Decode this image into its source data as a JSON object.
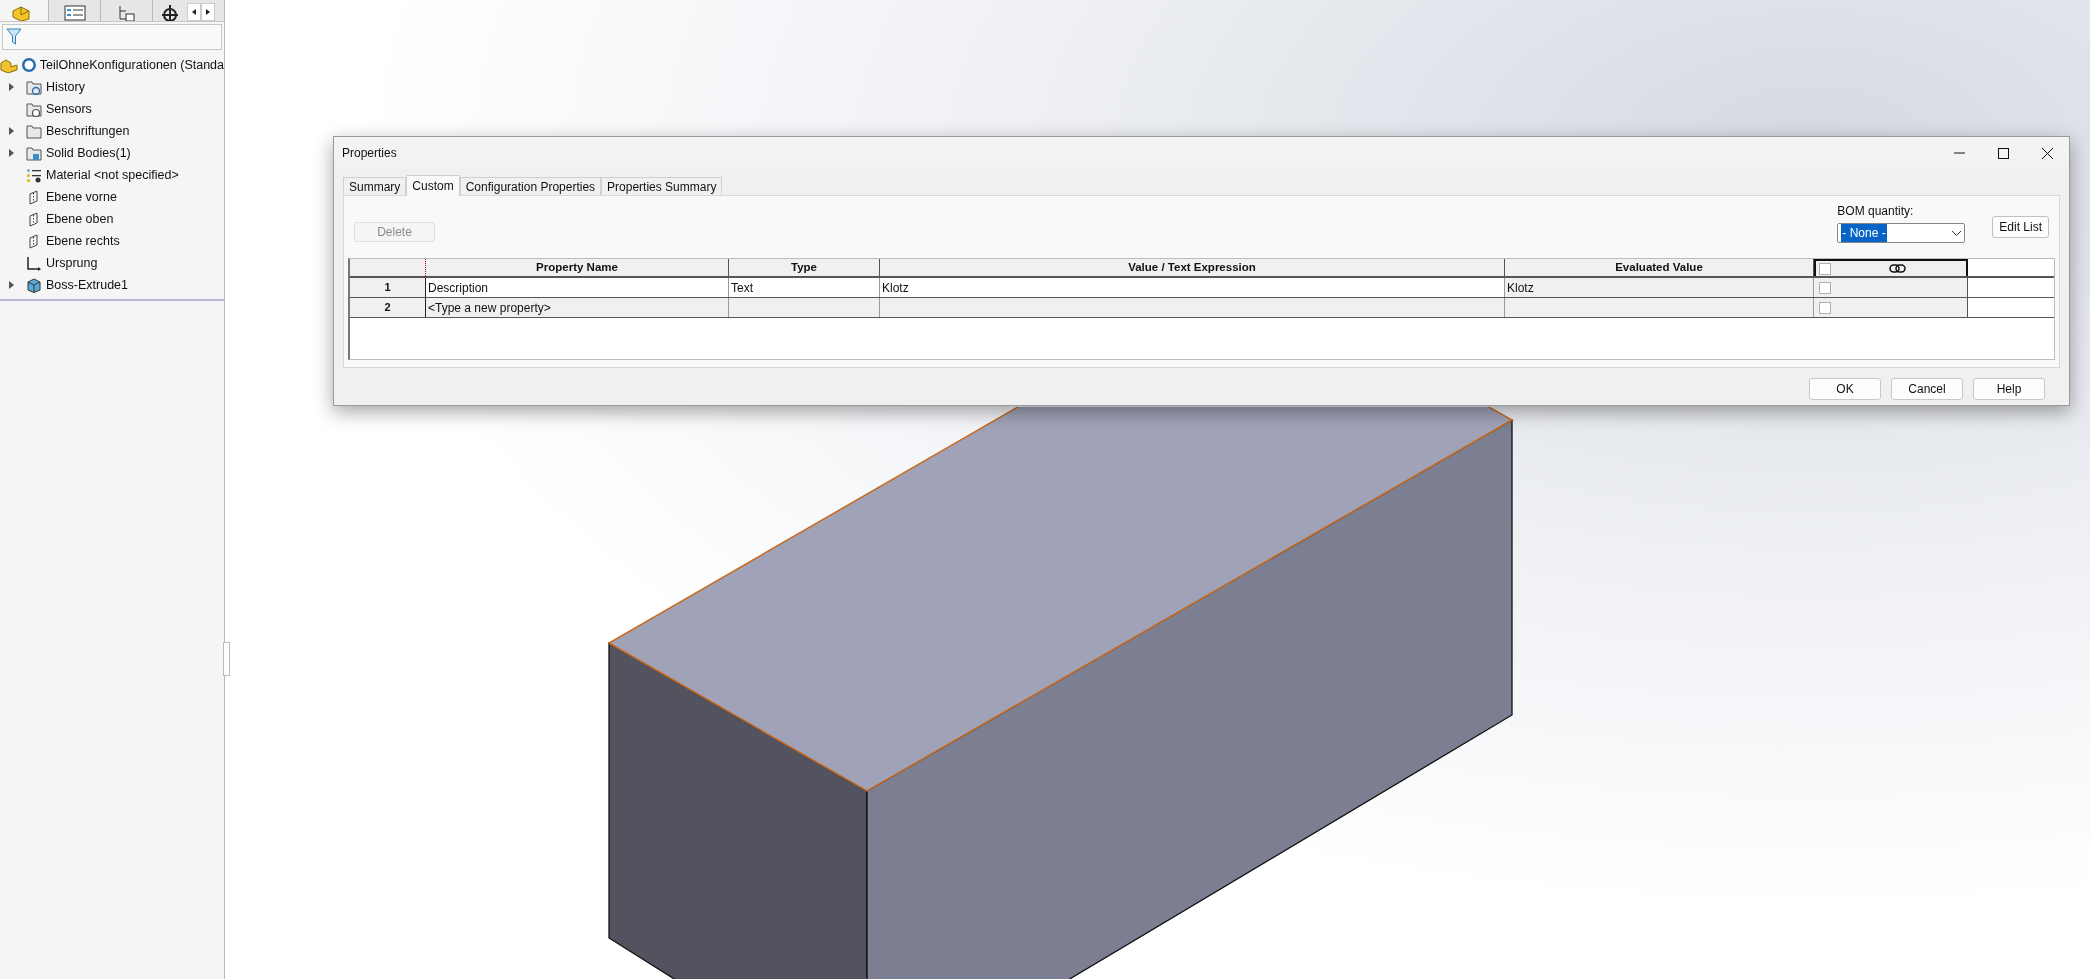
{
  "feature_tree": {
    "root": {
      "label": "TeilOhneKonfigurationen (Standa"
    },
    "items": [
      {
        "label": "History",
        "kind": "history",
        "expandable": true
      },
      {
        "label": "Sensors",
        "kind": "sensors",
        "expandable": false
      },
      {
        "label": "Beschriftungen",
        "kind": "annotations",
        "expandable": true
      },
      {
        "label": "Solid Bodies(1)",
        "kind": "bodies",
        "expandable": true
      },
      {
        "label": "Material <not specified>",
        "kind": "material",
        "expandable": false
      },
      {
        "label": "Ebene vorne",
        "kind": "plane",
        "expandable": false
      },
      {
        "label": "Ebene oben",
        "kind": "plane",
        "expandable": false
      },
      {
        "label": "Ebene rechts",
        "kind": "plane",
        "expandable": false
      },
      {
        "label": "Ursprung",
        "kind": "origin",
        "expandable": false
      },
      {
        "label": "Boss-Extrude1",
        "kind": "feature",
        "expandable": true
      }
    ]
  },
  "dialog": {
    "title": "Properties",
    "tabs": [
      {
        "label": "Summary",
        "selected": false
      },
      {
        "label": "Custom",
        "selected": true
      },
      {
        "label": "Configuration Properties",
        "selected": false
      },
      {
        "label": "Properties Summary",
        "selected": false
      }
    ],
    "delete_button": {
      "label": "Delete",
      "disabled": true
    },
    "bom_quantity": {
      "label": "BOM quantity:",
      "value": "- None -"
    },
    "edit_list_button": "Edit List",
    "table": {
      "columns": [
        "Property Name",
        "Type",
        "Value / Text Expression",
        "Evaluated Value"
      ],
      "header_checked": false,
      "rows": [
        {
          "number": "1",
          "property_name": "Description",
          "type": "Text",
          "value": "Klotz",
          "evaluated": "Klotz",
          "checked": false
        },
        {
          "number": "2",
          "property_name": "<Type a new property>",
          "type": "",
          "value": "",
          "evaluated": "",
          "checked": false
        }
      ]
    },
    "buttons": [
      "OK",
      "Cancel",
      "Help"
    ]
  }
}
